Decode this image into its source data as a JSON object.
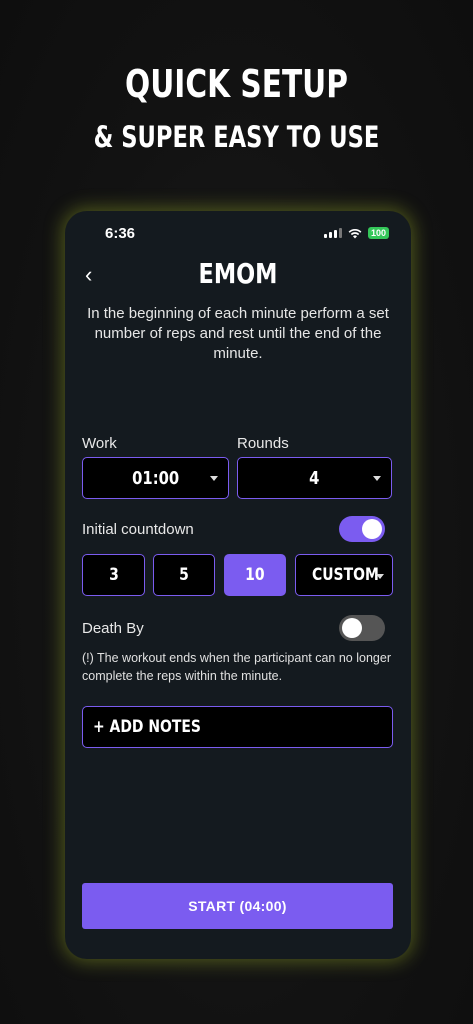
{
  "promo": {
    "headline": "QUICK SETUP",
    "subheadline": "& SUPER EASY TO USE"
  },
  "status_bar": {
    "time": "6:36",
    "battery": "100",
    "battery_color": "#34c759"
  },
  "screen": {
    "back_icon": "‹",
    "title": "EMOM",
    "description": "In the beginning of each minute perform a set number of reps and rest until the end of the minute."
  },
  "work": {
    "label": "Work",
    "value": "01:00"
  },
  "rounds": {
    "label": "Rounds",
    "value": "4"
  },
  "initial_countdown": {
    "label": "Initial countdown",
    "enabled": true,
    "options": [
      "3",
      "5",
      "10",
      "CUSTOM"
    ],
    "selected": "10"
  },
  "death_by": {
    "label": "Death By",
    "enabled": false,
    "note": "(!) The workout ends when the participant can no longer complete the reps within the minute."
  },
  "add_notes_label": "+ ADD NOTES",
  "start_label": "START (04:00)",
  "colors": {
    "accent": "#7b5cf0",
    "background": "#141a1f"
  }
}
